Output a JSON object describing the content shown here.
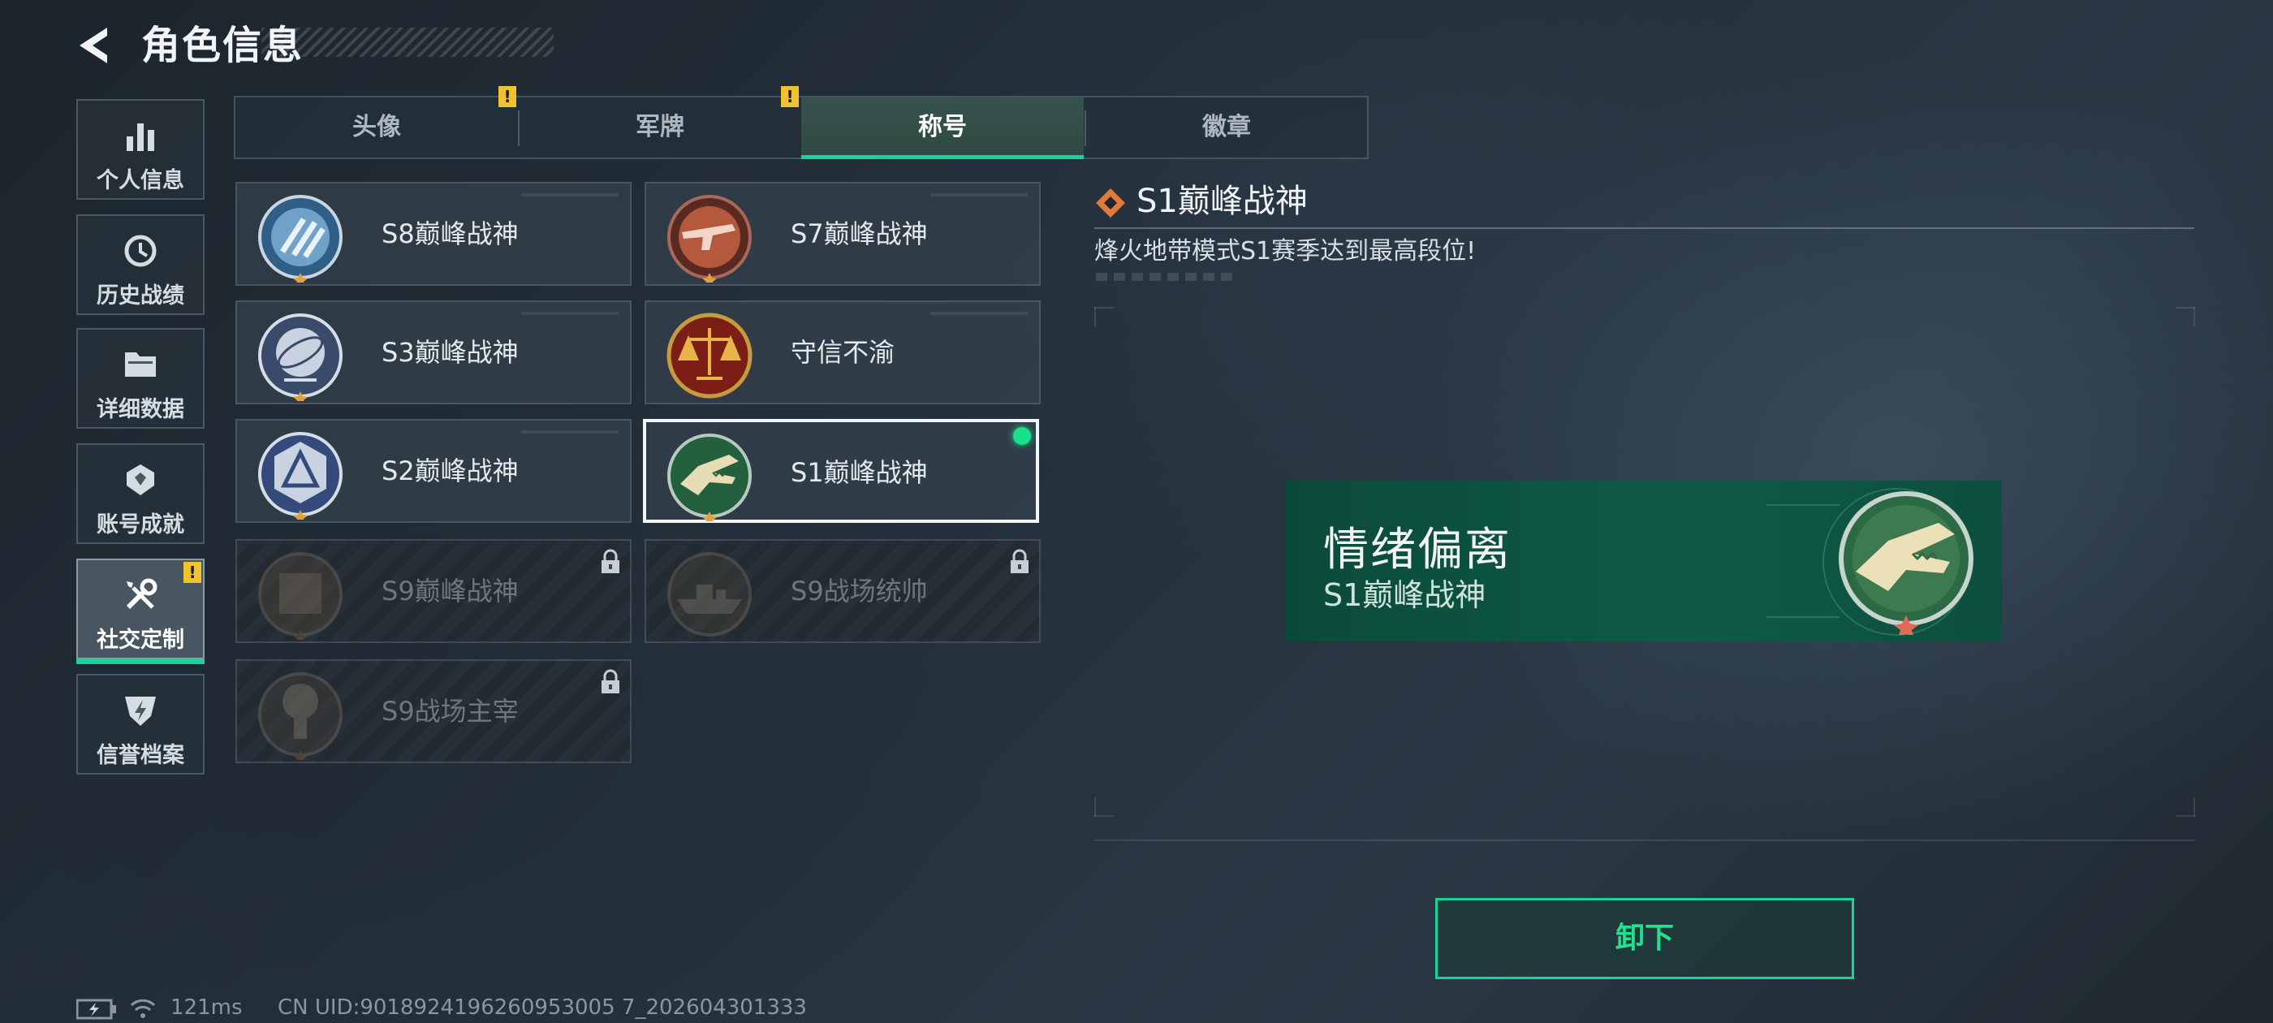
{
  "header": {
    "title": "角色信息"
  },
  "sidebar": {
    "items": [
      {
        "label": "个人信息",
        "icon": "bar-chart-icon"
      },
      {
        "label": "历史战绩",
        "icon": "history-icon"
      },
      {
        "label": "详细数据",
        "icon": "folder-icon"
      },
      {
        "label": "账号成就",
        "icon": "achievement-icon"
      },
      {
        "label": "社交定制",
        "icon": "tools-icon",
        "active": true,
        "alert": "!"
      },
      {
        "label": "信誉档案",
        "icon": "shield-icon"
      }
    ]
  },
  "tabs": [
    {
      "label": "头像",
      "alert": "!"
    },
    {
      "label": "军牌",
      "alert": "!"
    },
    {
      "label": "称号",
      "active": true
    },
    {
      "label": "徽章"
    }
  ],
  "titles": [
    {
      "name": "S8巅峰战神",
      "badge": "s8-badge-icon"
    },
    {
      "name": "S7巅峰战神",
      "badge": "s7-badge-icon"
    },
    {
      "name": "S3巅峰战神",
      "badge": "s3-badge-icon"
    },
    {
      "name": "守信不渝",
      "badge": "scales-badge-icon"
    },
    {
      "name": "S2巅峰战神",
      "badge": "s2-badge-icon"
    },
    {
      "name": "S1巅峰战神",
      "badge": "crocodile-badge-icon",
      "selected": true,
      "equipped": true
    },
    {
      "name": "S9巅峰战神",
      "badge": "s9-badge-icon",
      "locked": true
    },
    {
      "name": "S9战场统帅",
      "badge": "ship-badge-icon",
      "locked": true
    },
    {
      "name": "S9战场主宰",
      "badge": "explosion-badge-icon",
      "locked": true
    }
  ],
  "detail": {
    "title": "S1巅峰战神",
    "description": "烽火地带模式S1赛季达到最高段位!"
  },
  "nameplate": {
    "player_name": "情绪偏离",
    "title": "S1巅峰战神"
  },
  "actions": {
    "unequip_label": "卸下"
  },
  "status": {
    "latency": "121ms",
    "uid": "CN UID:9018924196260953005 7_202604301333"
  },
  "colors": {
    "accent": "#19d49a",
    "warning": "#f0c230",
    "nameplate_bg": "#0e5a45"
  }
}
